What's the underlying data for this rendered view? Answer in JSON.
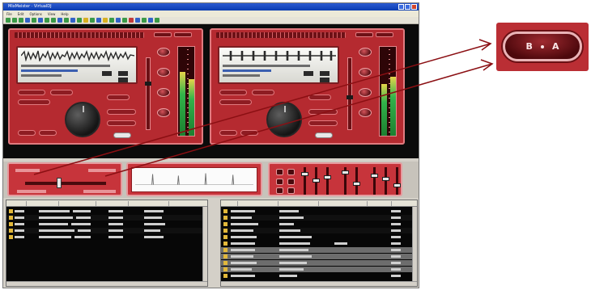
{
  "window": {
    "title": "MixMeister · VirtualDJ"
  },
  "menu": [
    "File",
    "Edit",
    "Options",
    "View",
    "Help"
  ],
  "crossfader": {
    "position_fraction": 0.42
  },
  "deck_a": {
    "pitch_fraction": 0.35,
    "vu_levels": [
      0.72,
      0.64
    ]
  },
  "deck_b": {
    "pitch_fraction": 0.55,
    "vu_levels": [
      0.58,
      0.66
    ]
  },
  "zoom_inset": {
    "left_label": "B",
    "right_label": "A"
  },
  "colors": {
    "deck_red": "#b52a30",
    "annotation_arrow": "#8b0f13",
    "vu_green": "#32b34a"
  }
}
